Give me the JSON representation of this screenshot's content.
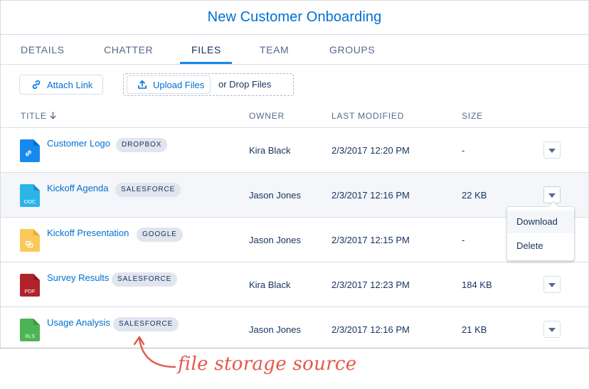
{
  "header": {
    "title": "New Customer Onboarding"
  },
  "tabs": [
    {
      "label": "DETAILS"
    },
    {
      "label": "CHATTER"
    },
    {
      "label": "FILES",
      "active": true
    },
    {
      "label": "TEAM"
    },
    {
      "label": "GROUPS"
    }
  ],
  "toolbar": {
    "attach_label": "Attach Link",
    "upload_label": "Upload Files",
    "drop_label": "or Drop Files"
  },
  "table": {
    "columns": {
      "title": "TITLE",
      "owner": "OWNER",
      "modified": "LAST MODIFIED",
      "size": "SIZE"
    },
    "rows": [
      {
        "name": "Customer Logo",
        "source": "DROPBOX",
        "owner": "Kira Black",
        "modified": "2/3/2017 12:20 PM",
        "size": "-",
        "icon": "link-file-icon",
        "icon_color": "#1589ee",
        "icon_label": ""
      },
      {
        "name": "Kickoff Agenda",
        "source": "SALESFORCE",
        "owner": "Jason Jones",
        "modified": "2/3/2017 12:16 PM",
        "size": "22 KB",
        "icon": "doc-file-icon",
        "icon_color": "#2bb4e8",
        "icon_label": "DOC"
      },
      {
        "name": "Kickoff Presentation",
        "source": "GOOGLE",
        "owner": "Jason Jones",
        "modified": "2/3/2017 12:15 PM",
        "size": "-",
        "icon": "slides-file-icon",
        "icon_color": "#fcc85a",
        "icon_label": ""
      },
      {
        "name": "Survey Results",
        "source": "SALESFORCE",
        "owner": "Kira Black",
        "modified": "2/3/2017 12:23 PM",
        "size": "184 KB",
        "icon": "pdf-file-icon",
        "icon_color": "#b0232a",
        "icon_label": "PDF"
      },
      {
        "name": "Usage Analysis",
        "source": "SALESFORCE",
        "owner": "Jason Jones",
        "modified": "2/3/2017 12:16 PM",
        "size": "21 KB",
        "icon": "xls-file-icon",
        "icon_color": "#4db454",
        "icon_label": "XLS"
      }
    ]
  },
  "row_menu": {
    "items": [
      {
        "label": "Download"
      },
      {
        "label": "Delete"
      }
    ]
  },
  "annotation": {
    "text": "file storage source",
    "color": "#e4584a"
  },
  "colors": {
    "link": "#0070d2",
    "text": "#16325c",
    "muted": "#54698d",
    "accent": "#1589ee"
  }
}
